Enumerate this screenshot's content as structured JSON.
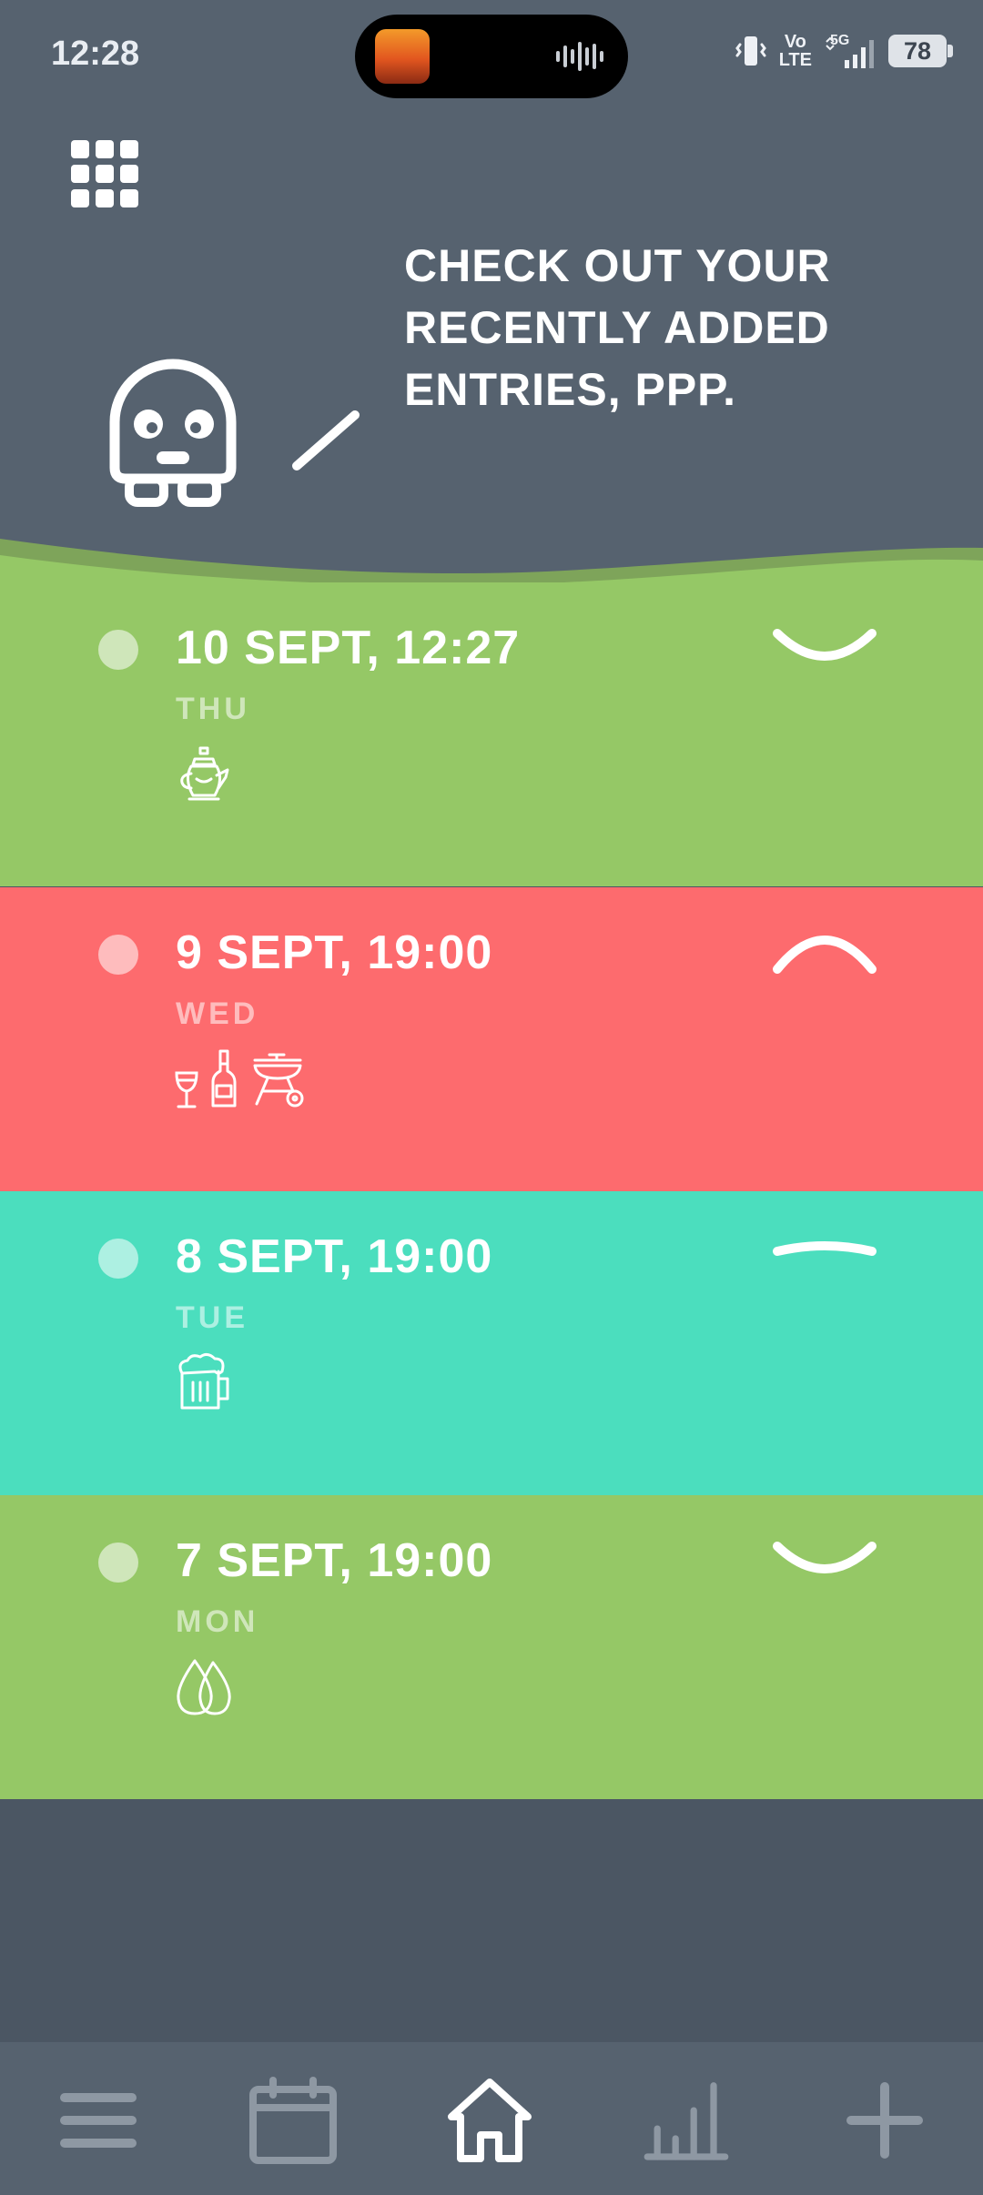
{
  "status_bar": {
    "time": "12:28",
    "network_top": "Vo",
    "network_bottom": "LTE",
    "network_5g": "5G",
    "battery": "78"
  },
  "banner": {
    "line1": "CHECK OUT YOUR",
    "line2": "RECENTLY ADDED",
    "line3": "ENTRIES, PPP."
  },
  "entries": [
    {
      "date": "10 SEPT, 12:27",
      "day": "THU",
      "mood": "happy",
      "color": "#95c866",
      "activities": [
        "teapot-icon"
      ]
    },
    {
      "date": "9 SEPT, 19:00",
      "day": "WED",
      "mood": "sad",
      "color": "#fd6b6e",
      "activities": [
        "wine-glass-icon",
        "bottle-icon",
        "grill-icon"
      ]
    },
    {
      "date": "8 SEPT, 19:00",
      "day": "TUE",
      "mood": "neutral",
      "color": "#4bdebe",
      "activities": [
        "beer-mug-icon"
      ]
    },
    {
      "date": "7 SEPT, 19:00",
      "day": "MON",
      "mood": "happy",
      "color": "#95c866",
      "activities": [
        "water-drops-icon"
      ]
    }
  ],
  "bottom_nav": {
    "items": [
      "menu-icon",
      "calendar-icon",
      "home-icon",
      "stats-icon",
      "add-icon"
    ],
    "active": "home-icon"
  }
}
